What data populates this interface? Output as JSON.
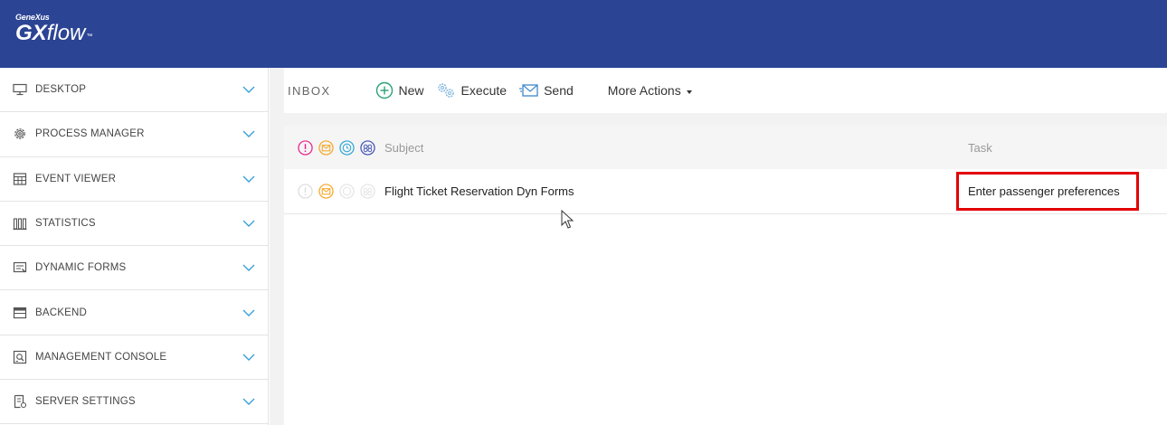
{
  "header": {
    "logo_small": "GeneXus",
    "logo_gx": "GX",
    "logo_flow": "flow",
    "logo_tm": "™"
  },
  "sidebar": {
    "items": [
      {
        "label": "DESKTOP",
        "icon": "monitor-icon"
      },
      {
        "label": "PROCESS MANAGER",
        "icon": "gear-icon"
      },
      {
        "label": "EVENT VIEWER",
        "icon": "calendar-icon"
      },
      {
        "label": "STATISTICS",
        "icon": "bar-chart-icon"
      },
      {
        "label": "DYNAMIC FORMS",
        "icon": "form-icon"
      },
      {
        "label": "BACKEND",
        "icon": "window-icon"
      },
      {
        "label": "MANAGEMENT CONSOLE",
        "icon": "console-icon"
      },
      {
        "label": "SERVER SETTINGS",
        "icon": "settings-document-icon"
      }
    ]
  },
  "toolbar": {
    "title": "INBOX",
    "new_label": "New",
    "execute_label": "Execute",
    "send_label": "Send",
    "more_actions_label": "More Actions"
  },
  "grid": {
    "columns": {
      "subject": "Subject",
      "task": "Task"
    },
    "rows": [
      {
        "subject": "Flight Ticket Reservation Dyn Forms",
        "task": "Enter passenger preferences"
      }
    ]
  },
  "colors": {
    "header_bg": "#2b4494",
    "priority": "#e91e8c",
    "mail": "#f5a623",
    "timer": "#2aa6d6",
    "participants": "#3f51b5",
    "highlight": "#e30000",
    "chevron": "#3aa0d9"
  }
}
